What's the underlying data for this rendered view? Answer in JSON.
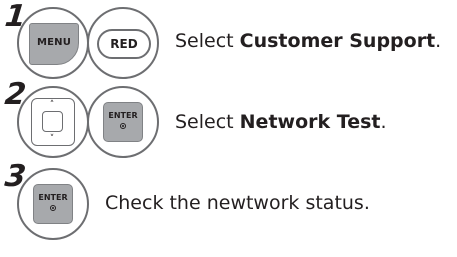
{
  "steps": [
    {
      "number": "1",
      "buttons": [
        "MENU",
        "RED"
      ],
      "text_prefix": "Select ",
      "text_bold": "Customer Support",
      "text_suffix": "."
    },
    {
      "number": "2",
      "buttons": [
        "navigation-pad",
        "ENTER"
      ],
      "text_prefix": "Select ",
      "text_bold": "Network Test",
      "text_suffix": "."
    },
    {
      "number": "3",
      "buttons": [
        "ENTER"
      ],
      "text_prefix": "Check the newtwork status.",
      "text_bold": "",
      "text_suffix": ""
    }
  ],
  "icons": {
    "up_arrow": "˄",
    "down_arrow": "˅"
  }
}
